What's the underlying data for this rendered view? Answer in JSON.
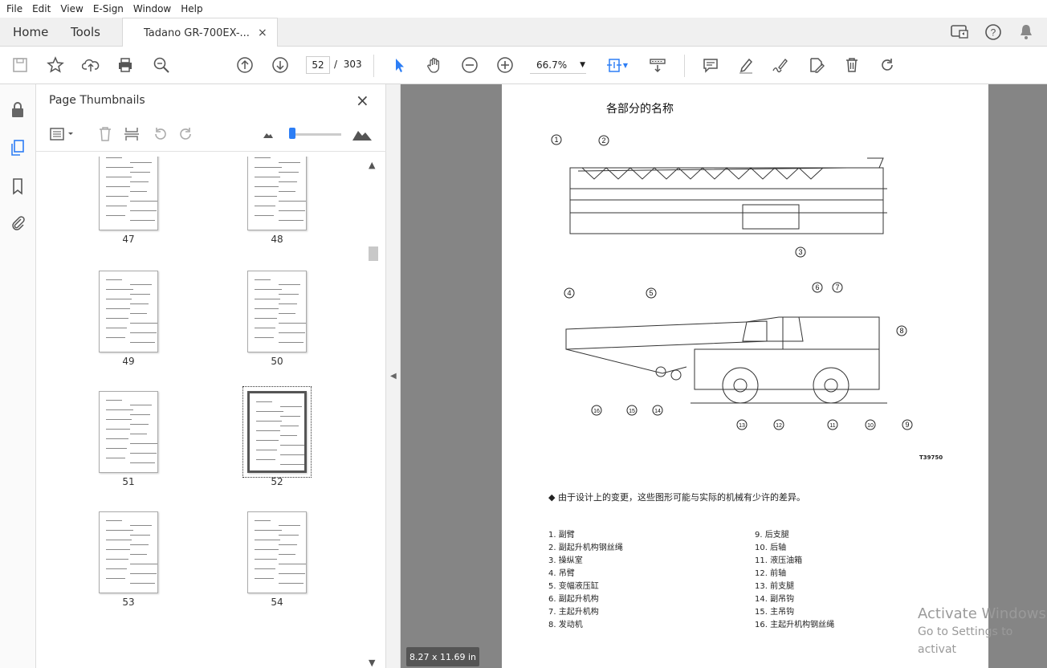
{
  "menu": [
    "File",
    "Edit",
    "View",
    "E-Sign",
    "Window",
    "Help"
  ],
  "tabs": {
    "home": "Home",
    "tools": "Tools",
    "doc": "Tadano GR-700EX-...",
    "close": "×"
  },
  "toolbar": {
    "page_current": "52",
    "page_sep": "/",
    "page_total": "303",
    "zoom": "66.7%"
  },
  "panel": {
    "title": "Page Thumbnails",
    "close": "×"
  },
  "thumbnails": [
    {
      "label": "47"
    },
    {
      "label": "48"
    },
    {
      "label": "49"
    },
    {
      "label": "50"
    },
    {
      "label": "51"
    },
    {
      "label": "52",
      "selected": true
    },
    {
      "label": "53"
    },
    {
      "label": "54"
    }
  ],
  "document": {
    "title": "各部分的名称",
    "figure_code": "T39750",
    "note": "◆  由于设计上的变更，这些图形可能与实际的机械有少许的差异。",
    "callouts": [
      "1",
      "2",
      "3",
      "4",
      "5",
      "6",
      "7",
      "8",
      "9",
      "10",
      "11",
      "12",
      "13",
      "14",
      "15",
      "16"
    ],
    "parts_left": [
      "1. 副臂",
      "2. 副起升机构钢丝绳",
      "3. 操纵室",
      "4. 吊臂",
      "5. 变幅液压缸",
      "6. 副起升机构",
      "7. 主起升机构",
      "8. 发动机"
    ],
    "parts_right": [
      "9. 后支腿",
      "10. 后轴",
      "11. 液压油箱",
      "12. 前轴",
      "13. 前支腿",
      "14. 副吊钩",
      "15. 主吊钩",
      "16. 主起升机构钢丝绳"
    ]
  },
  "status": {
    "page_size": "8.27 x 11.69 in"
  },
  "watermark": {
    "line1": "Activate Windows",
    "line2": "Go to Settings to activat"
  }
}
